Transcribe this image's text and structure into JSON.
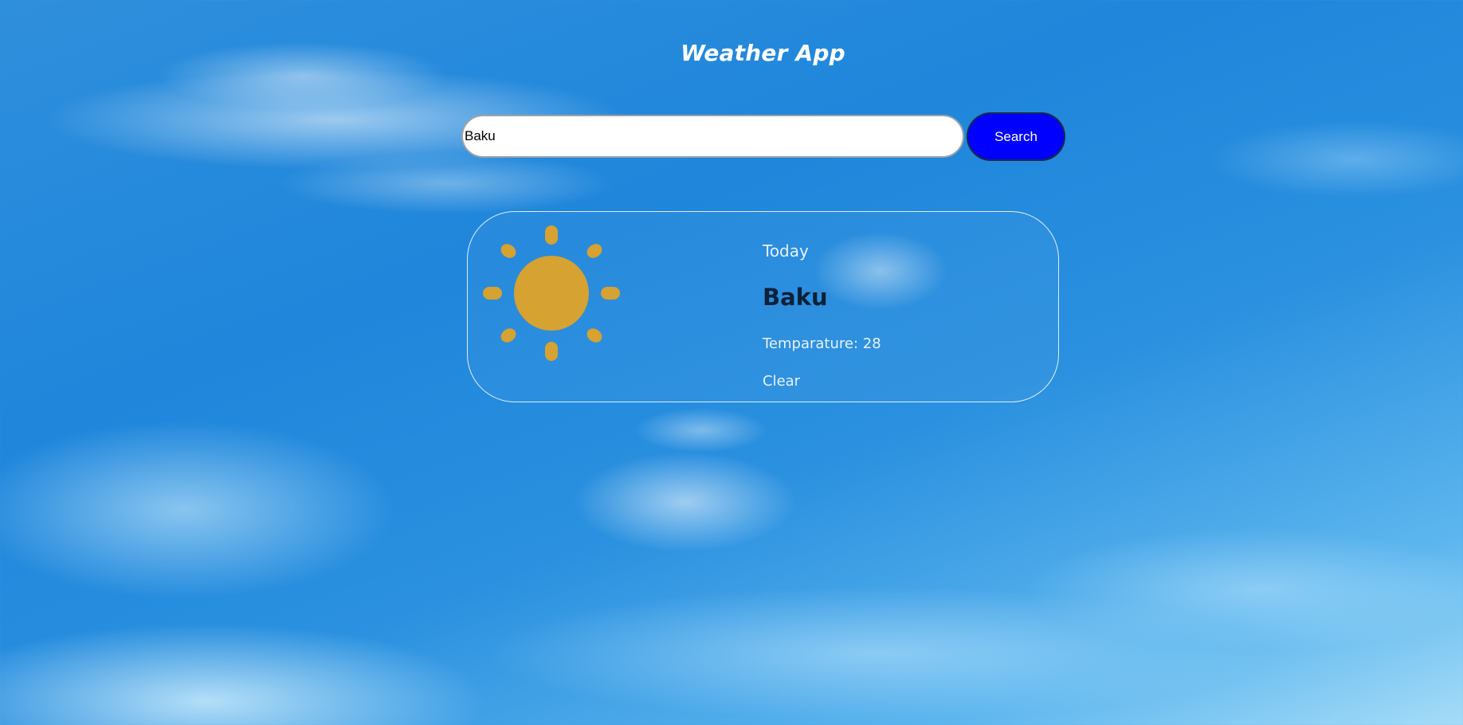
{
  "header": {
    "title": "Weather App"
  },
  "search": {
    "value": "Baku",
    "button_label": "Search"
  },
  "weather": {
    "day_label": "Today",
    "city": "Baku",
    "temperature_text": "Temparature: 28",
    "condition": "Clear",
    "icon": "sun-icon"
  },
  "colors": {
    "search_button": "#0000ff",
    "sun": "#d6a232",
    "city_text": "#0d2138"
  }
}
